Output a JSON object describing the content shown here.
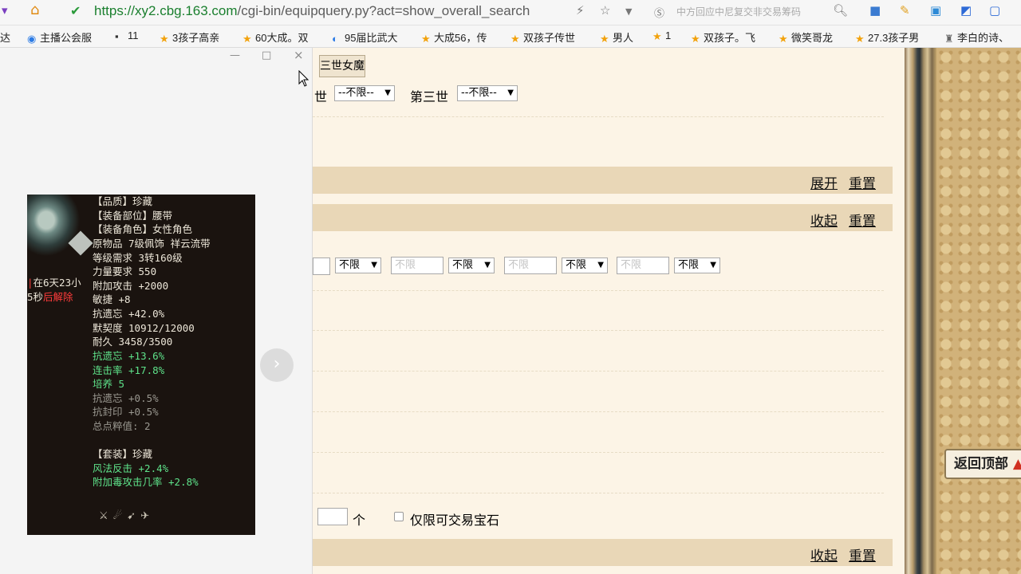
{
  "browser": {
    "url_host": "https://xy2.cbg.163.com",
    "url_path": "/cgi-bin/equipquery.py?act=show_overall_search",
    "search_text": "中方回应中尼复交非交易筹码"
  },
  "bookmarks": [
    {
      "label": "达",
      "icon": "tab-icon"
    },
    {
      "label": "主播公会服",
      "icon": "globe-icon"
    },
    {
      "label": "11",
      "icon": "film-icon"
    },
    {
      "label": "3孩子高亲",
      "icon": "star-icon"
    },
    {
      "label": "60大成。双",
      "icon": "star-icon"
    },
    {
      "label": "95届比武大",
      "icon": "browser-icon"
    },
    {
      "label": "大成56，传",
      "icon": "star-icon"
    },
    {
      "label": "双孩子传世",
      "icon": "star-icon"
    },
    {
      "label": "男人",
      "icon": "star-icon"
    },
    {
      "label": "1",
      "icon": "star-icon"
    },
    {
      "label": "双孩子。飞",
      "icon": "star-icon"
    },
    {
      "label": "微笑哥龙",
      "icon": "star-icon"
    },
    {
      "label": "27.3孩子男",
      "icon": "star-icon"
    },
    {
      "label": "李白的诗、",
      "icon": "poem-icon"
    }
  ],
  "popup": {
    "item": {
      "quality": "【品质】珍藏",
      "slot": "【装备部位】腰带",
      "role": "【装备角色】女性角色",
      "origin": "原物品 7级佩饰 祥云流带",
      "level": "等级需求 3转160级",
      "strength": "力量要求 550",
      "attack": "附加攻击 +2000",
      "agility": "敏捷 +8",
      "resist_forget": "抗遗忘 +42.0%",
      "tacit": "默契度 10912/12000",
      "durability": "耐久 3458/3500",
      "bonus_1": "抗遗忘 +13.6%",
      "bonus_2": "连击率 +17.8%",
      "bonus_3": "培养 5",
      "extra_1": "抗遗忘 +0.5%",
      "extra_2": "抗封印 +0.5%",
      "total": "总点粹值: 2",
      "set_name": "【套装】珍藏",
      "set_1": "风法反击 +2.4%",
      "set_2": "附加毒攻击几率 +2.8%",
      "timer_1": "在6天23小",
      "timer_2": "5秒",
      "timer_3": "后解除"
    },
    "next": "›",
    "win_min": "—",
    "win_max": "□",
    "win_close": "×"
  },
  "page": {
    "third_world_btn": "三世女魔",
    "second_world_label": "世",
    "third_world_label": "第三世",
    "select_any": "--不限--",
    "band_1": {
      "expand": "展开",
      "reset": "重置"
    },
    "band_2": {
      "collapse": "收起",
      "reset": "重置"
    },
    "band_3": {
      "collapse": "收起",
      "reset": "重置"
    },
    "unlimited": "不限",
    "input_placeholder": "不限",
    "unit": "个",
    "tradable_gem": "仅限可交易宝石",
    "back_to_top": "返回顶部"
  }
}
